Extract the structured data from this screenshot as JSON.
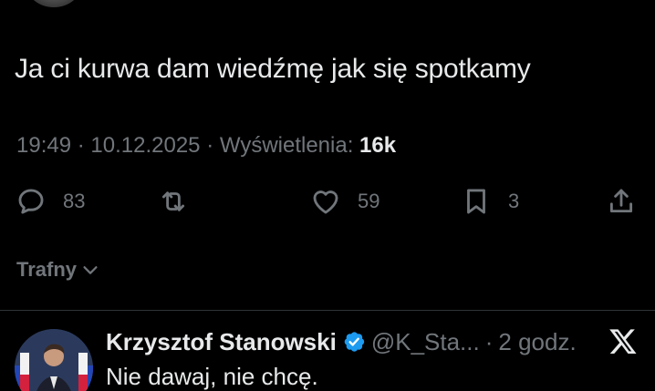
{
  "tweet": {
    "text": "Ja ci kurwa dam wiedźmę jak się spotkamy",
    "time": "19:49",
    "date": "10.12.2025",
    "separator": "·",
    "views_label": "Wyświetlenia:",
    "views_count": "16k"
  },
  "actions": {
    "replies": "83",
    "retweets": "",
    "likes": "59",
    "bookmarks": "3"
  },
  "sort": {
    "label": "Trafny"
  },
  "reply": {
    "name": "Krzysztof Stanowski",
    "handle": "@K_Sta...",
    "separator": "·",
    "time": "2 godz.",
    "text": "Nie dawaj, nie chcę."
  },
  "icons": {
    "reply": "speech-bubble-icon",
    "retweet": "retweet-icon",
    "like": "heart-icon",
    "bookmark": "bookmark-icon",
    "share": "share-icon",
    "verified": "verified-badge-icon",
    "platform": "x-logo-icon",
    "sort": "chevron-down-icon"
  },
  "colors": {
    "background": "#000000",
    "text_primary": "#e7e9ea",
    "text_secondary": "#71767b",
    "divider": "#2f3336",
    "verified": "#1d9bf0"
  }
}
